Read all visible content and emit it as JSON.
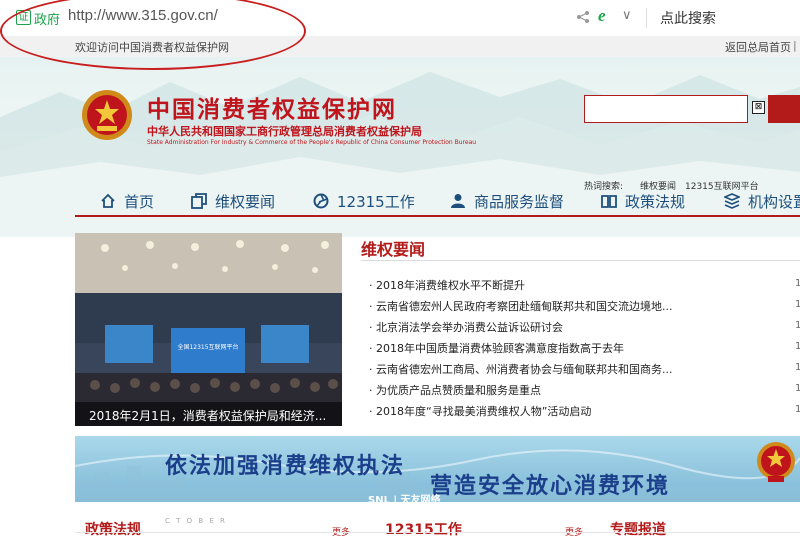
{
  "browser": {
    "cert_icon_text": "证",
    "gov_label": "政府",
    "url": "http://www.315.gov.cn/",
    "search_label": "点此搜索",
    "ie_icon_text": "e",
    "chevron": "∨"
  },
  "topbar": {
    "welcome": "欢迎访问中国消费者权益保护网",
    "return_home": "返回总局首页",
    "trailing": "|"
  },
  "header": {
    "title": "中国消费者权益保护网",
    "subtitle": "中华人民共和国国家工商行政管理总局消费者权益保护局",
    "english": "State Administration For Industry & Commerce of the People's Republic of China Consumer Protection Bureau",
    "search_close": "⊠",
    "hot_label": "热词搜索:",
    "hot_words": [
      "维权要闻",
      "12315互联网平台"
    ]
  },
  "nav": {
    "items": [
      {
        "label": "首页",
        "icon": "home-icon"
      },
      {
        "label": "维权要闻",
        "icon": "copy-icon"
      },
      {
        "label": "12315工作",
        "icon": "aperture-icon"
      },
      {
        "label": "商品服务监督",
        "icon": "person-icon"
      },
      {
        "label": "政策法规",
        "icon": "book-icon"
      },
      {
        "label": "机构设置",
        "icon": "layers-icon"
      }
    ]
  },
  "feature": {
    "caption": "2018年2月1日，消费者权益保护局和经济...",
    "screen_text": "全国12315互联网平台"
  },
  "news": {
    "heading": "维权要闻",
    "items": [
      "2018年消费维权水平不断提升",
      "云南省德宏州人民政府考察团赴缅甸联邦共和国交流边境地...",
      "北京消法学会举办消费公益诉讼研讨会",
      "2018年中国质量消费体验顾客满意度指数高于去年",
      "云南省德宏州工商局、州消费者协会与缅甸联邦共和国商务...",
      "为优质产品点赞质量和服务是重点",
      "2018年度“寻找最美消费维权人物”活动启动"
    ],
    "tails": [
      "1",
      "1",
      "1",
      "1",
      "1",
      "1",
      "1"
    ]
  },
  "banner": {
    "left_text": "依法加强消费维权执法",
    "right_text": "营造安全放心消费环境",
    "brand": "SNL | 天友网络"
  },
  "bottom": {
    "policy": "政策法规",
    "work": "12315工作",
    "topic": "专题报道",
    "more": "更多",
    "deco": "C  T  O  B  E  R"
  },
  "colors": {
    "brand_red": "#c0141c",
    "nav_blue": "#1e4f7c",
    "gov_green": "#1aa34a"
  }
}
